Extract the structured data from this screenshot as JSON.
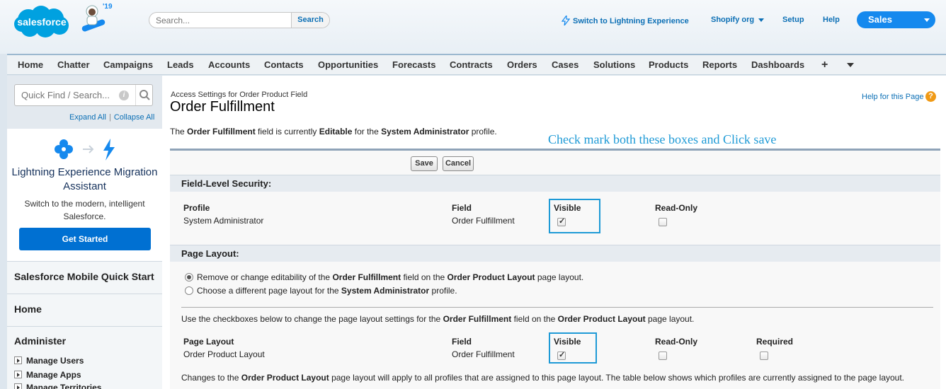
{
  "header": {
    "logo_text": "salesforce",
    "mascot_badge": "'19",
    "search_placeholder": "Search...",
    "search_button": "Search",
    "lightning_link": "Switch to Lightning Experience",
    "org_menu": "Shopify org",
    "setup_link": "Setup",
    "help_link": "Help",
    "app_name": "Sales"
  },
  "tabs": [
    "Home",
    "Chatter",
    "Campaigns",
    "Leads",
    "Accounts",
    "Contacts",
    "Opportunities",
    "Forecasts",
    "Contracts",
    "Orders",
    "Cases",
    "Solutions",
    "Products",
    "Reports",
    "Dashboards",
    "+"
  ],
  "sidebar": {
    "quick_find_placeholder": "Quick Find / Search...",
    "expand_all": "Expand All",
    "collapse_all": "Collapse All",
    "migration_title": "Lightning Experience Migration Assistant",
    "migration_desc": "Switch to the modern, intelligent Salesforce.",
    "get_started": "Get Started",
    "mobile_quick_start": "Salesforce Mobile Quick Start",
    "home": "Home",
    "administer": "Administer",
    "admin_items": [
      "Manage Users",
      "Manage Apps",
      "Manage Territories"
    ]
  },
  "main": {
    "breadcrumb": "Access Settings for Order Product Field",
    "title": "Order Fulfillment",
    "help_text": "Help for this Page",
    "intro": {
      "p1": "The ",
      "field": "Order Fulfillment",
      "p2": " field is currently ",
      "state": "Editable",
      "p3": " for the ",
      "profile": "System Administrator",
      "p4": " profile."
    },
    "annotation": "Check mark both these boxes and Click save",
    "save": "Save",
    "cancel": "Cancel",
    "fls": {
      "heading": "Field-Level Security:",
      "col_profile": "Profile",
      "col_field": "Field",
      "col_visible": "Visible",
      "col_readonly": "Read-Only",
      "profile": "System Administrator",
      "field": "Order Fulfillment",
      "visible": true,
      "readonly": false
    },
    "layout": {
      "heading": "Page Layout:",
      "opt1": {
        "a": "Remove or change editability of the ",
        "field": "Order Fulfillment",
        "b": " field on the ",
        "layout": "Order Product Layout",
        "c": " page layout."
      },
      "opt2": {
        "a": "Choose a different page layout for the ",
        "profile": "System Administrator",
        "b": " profile."
      },
      "instr": {
        "a": "Use the checkboxes below to change the page layout settings for the ",
        "field": "Order Fulfillment",
        "b": " field on the ",
        "layout": "Order Product Layout",
        "c": " page layout."
      },
      "col_layout": "Page Layout",
      "col_field": "Field",
      "col_visible": "Visible",
      "col_readonly": "Read-Only",
      "col_required": "Required",
      "layout_name": "Order Product Layout",
      "field": "Order Fulfillment",
      "visible": true,
      "readonly": false,
      "required": false,
      "note": {
        "a": "Changes to the ",
        "layout": "Order Product Layout",
        "b": " page layout will apply to all profiles that are assigned to this page layout. The table below shows which profiles are currently assigned to the page layout."
      }
    }
  },
  "colors": {
    "link": "#0b6fb5",
    "brand": "#1589ee",
    "annotation": "#1e9ad6"
  }
}
